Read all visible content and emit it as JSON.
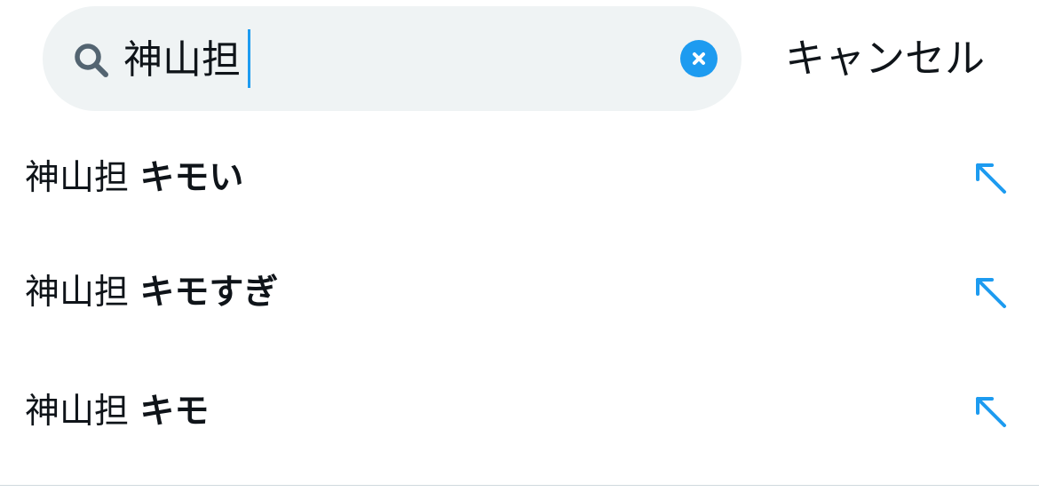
{
  "search": {
    "query": "神山担",
    "clear_icon": "close-icon",
    "search_icon": "search-icon"
  },
  "cancel_label": "キャンセル",
  "suggestions": [
    {
      "query": "神山担",
      "completion": "キモい",
      "icon": "arrow-up-left-icon"
    },
    {
      "query": "神山担",
      "completion": "キモすぎ",
      "icon": "arrow-up-left-icon"
    },
    {
      "query": "神山担",
      "completion": "キモ",
      "icon": "arrow-up-left-icon"
    }
  ],
  "colors": {
    "accent": "#1d9bf0",
    "search_background": "#eff3f4",
    "text": "#0f1419",
    "icon_gray": "#536471"
  }
}
